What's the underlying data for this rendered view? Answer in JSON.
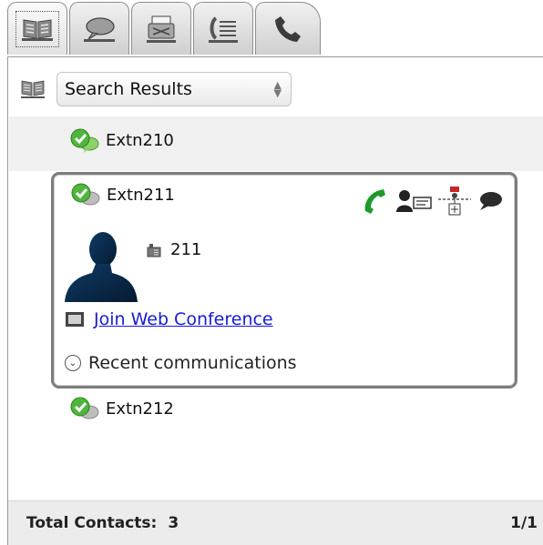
{
  "tabs": [
    {
      "icon": "contacts-book-icon",
      "active": true
    },
    {
      "icon": "chat-bubble-icon",
      "active": false
    },
    {
      "icon": "fax-icon",
      "active": false
    },
    {
      "icon": "call-log-icon",
      "active": false
    },
    {
      "icon": "phone-icon",
      "active": false
    }
  ],
  "search": {
    "dropdown_value": "Search Results"
  },
  "contacts": [
    {
      "name": "Extn210"
    },
    {
      "name": "Extn211",
      "extension": "211",
      "join_label": "Join Web Conference",
      "recent_label": "Recent communications"
    },
    {
      "name": "Extn212"
    }
  ],
  "footer": {
    "total_label": "Total Contacts:",
    "total_value": "3",
    "page": "1/1"
  }
}
